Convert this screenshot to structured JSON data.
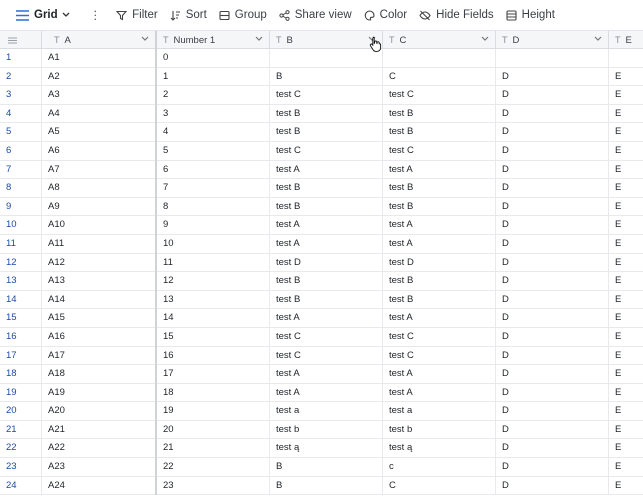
{
  "toolbar": {
    "view_label": "Grid",
    "more_label": "⋮",
    "filter_label": "Filter",
    "sort_label": "Sort",
    "group_label": "Group",
    "share_label": "Share view",
    "color_label": "Color",
    "hide_label": "Hide Fields",
    "height_label": "Height"
  },
  "columns": [
    "A",
    "Number 1",
    "B",
    "C",
    "D",
    "E"
  ],
  "rows": [
    {
      "id": "1",
      "a": "A1",
      "n": "0",
      "b": "",
      "c": "",
      "d": "",
      "e": ""
    },
    {
      "id": "2",
      "a": "A2",
      "n": "1",
      "b": "B",
      "c": "C",
      "d": "D",
      "e": "E"
    },
    {
      "id": "3",
      "a": "A3",
      "n": "2",
      "b": "test C",
      "c": "test C",
      "d": "D",
      "e": "E"
    },
    {
      "id": "4",
      "a": "A4",
      "n": "3",
      "b": "test B",
      "c": "test B",
      "d": "D",
      "e": "E"
    },
    {
      "id": "5",
      "a": "A5",
      "n": "4",
      "b": "test B",
      "c": "test B",
      "d": "D",
      "e": "E"
    },
    {
      "id": "6",
      "a": "A6",
      "n": "5",
      "b": "test C",
      "c": "test C",
      "d": "D",
      "e": "E"
    },
    {
      "id": "7",
      "a": "A7",
      "n": "6",
      "b": "test A",
      "c": "test A",
      "d": "D",
      "e": "E"
    },
    {
      "id": "8",
      "a": "A8",
      "n": "7",
      "b": "test B",
      "c": "test B",
      "d": "D",
      "e": "E"
    },
    {
      "id": "9",
      "a": "A9",
      "n": "8",
      "b": "test B",
      "c": "test B",
      "d": "D",
      "e": "E"
    },
    {
      "id": "10",
      "a": "A10",
      "n": "9",
      "b": "test A",
      "c": "test A",
      "d": "D",
      "e": "E"
    },
    {
      "id": "11",
      "a": "A11",
      "n": "10",
      "b": "test A",
      "c": "test A",
      "d": "D",
      "e": "E"
    },
    {
      "id": "12",
      "a": "A12",
      "n": "11",
      "b": "test D",
      "c": "test D",
      "d": "D",
      "e": "E"
    },
    {
      "id": "13",
      "a": "A13",
      "n": "12",
      "b": "test B",
      "c": "test B",
      "d": "D",
      "e": "E"
    },
    {
      "id": "14",
      "a": "A14",
      "n": "13",
      "b": "test B",
      "c": "test B",
      "d": "D",
      "e": "E"
    },
    {
      "id": "15",
      "a": "A15",
      "n": "14",
      "b": "test A",
      "c": "test A",
      "d": "D",
      "e": "E"
    },
    {
      "id": "16",
      "a": "A16",
      "n": "15",
      "b": "test C",
      "c": "test C",
      "d": "D",
      "e": "E"
    },
    {
      "id": "17",
      "a": "A17",
      "n": "16",
      "b": "test C",
      "c": "test C",
      "d": "D",
      "e": "E"
    },
    {
      "id": "18",
      "a": "A18",
      "n": "17",
      "b": "test A",
      "c": "test A",
      "d": "D",
      "e": "E"
    },
    {
      "id": "19",
      "a": "A19",
      "n": "18",
      "b": "test A",
      "c": "test A",
      "d": "D",
      "e": "E"
    },
    {
      "id": "20",
      "a": "A20",
      "n": "19",
      "b": "test a",
      "c": "test a",
      "d": "D",
      "e": "E"
    },
    {
      "id": "21",
      "a": "A21",
      "n": "20",
      "b": "test b",
      "c": "test b",
      "d": "D",
      "e": "E"
    },
    {
      "id": "22",
      "a": "A22",
      "n": "21",
      "b": "test ą",
      "c": "test ą",
      "d": "D",
      "e": "E"
    },
    {
      "id": "23",
      "a": "A23",
      "n": "22",
      "b": "B",
      "c": "c",
      "d": "D",
      "e": "E"
    },
    {
      "id": "24",
      "a": "A24",
      "n": "23",
      "b": "B",
      "c": "C",
      "d": "D",
      "e": "E"
    }
  ],
  "colors": {
    "accent": "#1b4aa6",
    "header_bg": "#f5f6f8",
    "border": "#e7e9ec"
  }
}
